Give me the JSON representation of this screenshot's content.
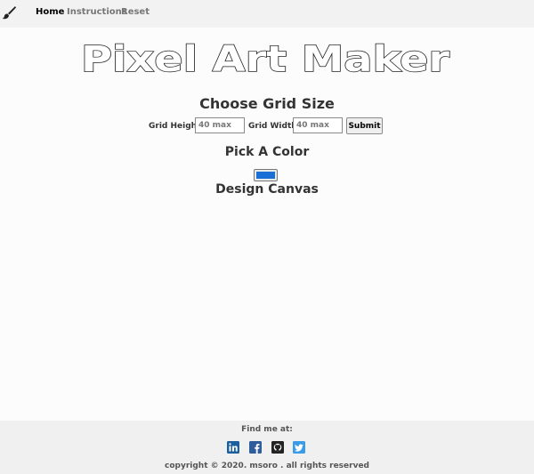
{
  "nav": {
    "icon": "paintbrush-icon",
    "items": [
      "Home",
      "Instructions",
      "Reset"
    ],
    "active": "Home"
  },
  "title": "Pixel Art Maker",
  "grid": {
    "heading": "Choose Grid Size",
    "height_label": "Grid Height:",
    "height_placeholder": "40 max",
    "width_label": "Grid Width:",
    "width_placeholder": "40 max",
    "submit_label": "Submit"
  },
  "color": {
    "heading": "Pick A Color",
    "value": "#1a6fd6"
  },
  "canvas": {
    "heading": "Design Canvas"
  },
  "footer": {
    "find_me": "Find me at:",
    "socials": [
      "linkedin-icon",
      "facebook-icon",
      "github-icon",
      "twitter-icon"
    ],
    "copyright": "copyright © 2020. msoro . all rights reserved"
  }
}
